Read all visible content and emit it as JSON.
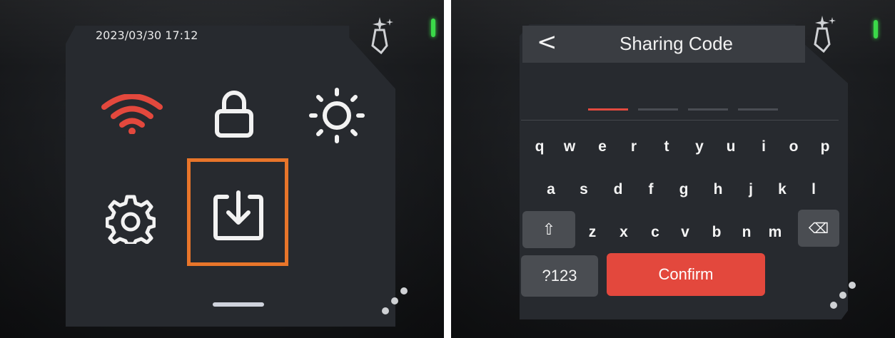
{
  "left_panel": {
    "datetime": "2023/03/30 17:12",
    "icons": [
      "wifi-icon",
      "lock-icon",
      "brightness-icon",
      "settings-icon",
      "download-icon"
    ]
  },
  "right_panel": {
    "back_label": "<",
    "title": "Sharing Code",
    "code_slots": 4,
    "keyboard": {
      "row1": [
        "q",
        "w",
        "e",
        "r",
        "t",
        "y",
        "u",
        "i",
        "o",
        "p"
      ],
      "row2": [
        "a",
        "s",
        "d",
        "f",
        "g",
        "h",
        "j",
        "k",
        "l"
      ],
      "row3": [
        "z",
        "x",
        "c",
        "v",
        "b",
        "n",
        "m"
      ],
      "shift_label": "⇧",
      "backspace_label": "⌫",
      "symbols_label": "?123",
      "confirm_label": "Confirm"
    }
  },
  "colors": {
    "accent_red": "#e3483d",
    "highlight_orange": "#e8752a",
    "led_green": "#3bd949",
    "screen": "#272a2f"
  }
}
